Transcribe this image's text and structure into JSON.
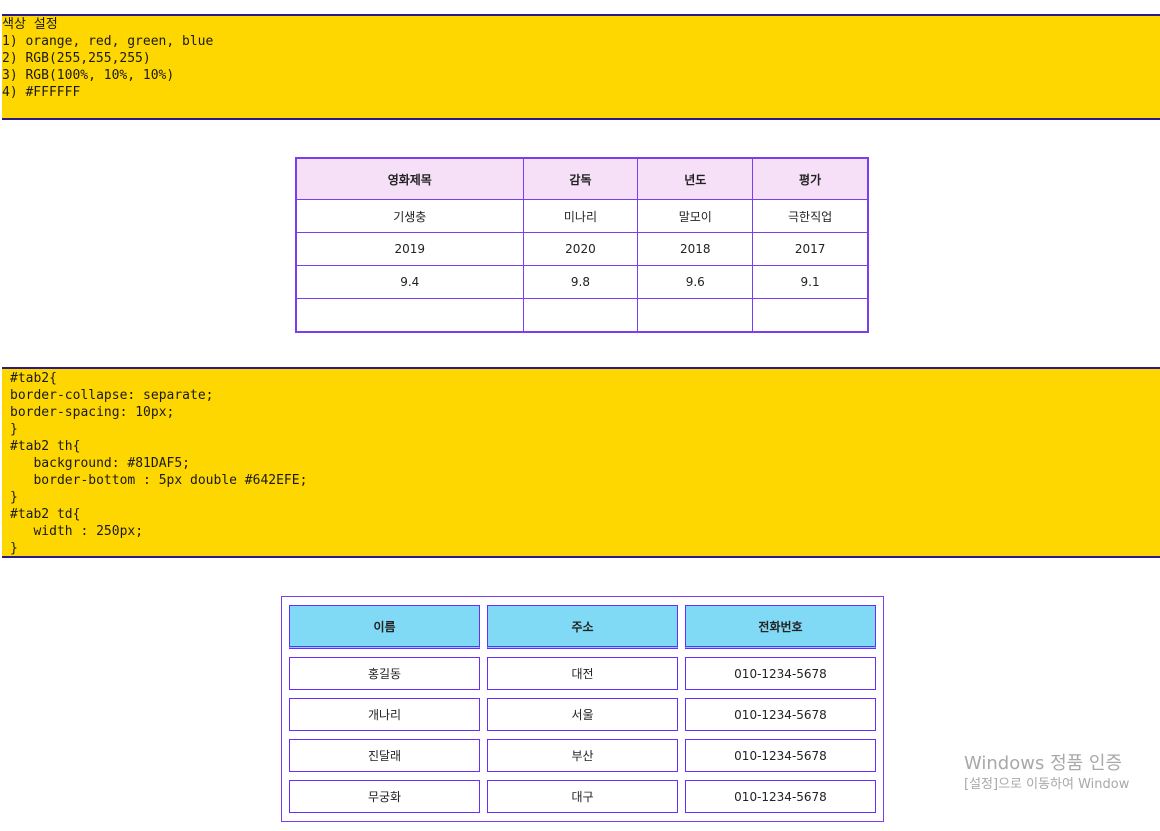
{
  "color_block": {
    "lines": [
      "색상 설정",
      "1) orange, red, green, blue",
      "2) RGB(255,255,255)",
      "3) RGB(100%, 10%, 10%)",
      "4) #FFFFFF"
    ]
  },
  "tab1": {
    "headers": [
      "영화제목",
      "감독",
      "년도",
      "평가"
    ],
    "rows": [
      [
        "기생충",
        "미나리",
        "말모이",
        "극한직업"
      ],
      [
        "2019",
        "2020",
        "2018",
        "2017"
      ],
      [
        "9.4",
        "9.8",
        "9.6",
        "9.1"
      ],
      [
        "",
        "",
        "",
        ""
      ]
    ]
  },
  "code_block": {
    "lines": [
      "#tab2{",
      "border-collapse: separate;",
      "border-spacing: 10px;",
      "}",
      "#tab2 th{",
      "   background: #81DAF5;",
      "   border-bottom : 5px double #642EFE;",
      "}",
      "#tab2 td{",
      "   width : 250px;",
      "}"
    ]
  },
  "tab2": {
    "headers": [
      "이름",
      "주소",
      "전화번호"
    ],
    "rows": [
      [
        "홍길동",
        "대전",
        "010-1234-5678"
      ],
      [
        "개나리",
        "서울",
        "010-1234-5678"
      ],
      [
        "진달래",
        "부산",
        "010-1234-5678"
      ],
      [
        "무궁화",
        "대구",
        "010-1234-5678"
      ]
    ]
  },
  "watermark": {
    "title": "Windows 정품 인증",
    "subtitle": "[설정]으로 이동하여 Window"
  },
  "colors": {
    "block_bg": "#FFD700",
    "block_border": "#2a1a8a",
    "tab1_header_bg": "#F6E0F8",
    "tab1_border": "#7a3ef0",
    "tab2_header_bg": "#81DAF5",
    "tab2_border": "#642EFE"
  }
}
